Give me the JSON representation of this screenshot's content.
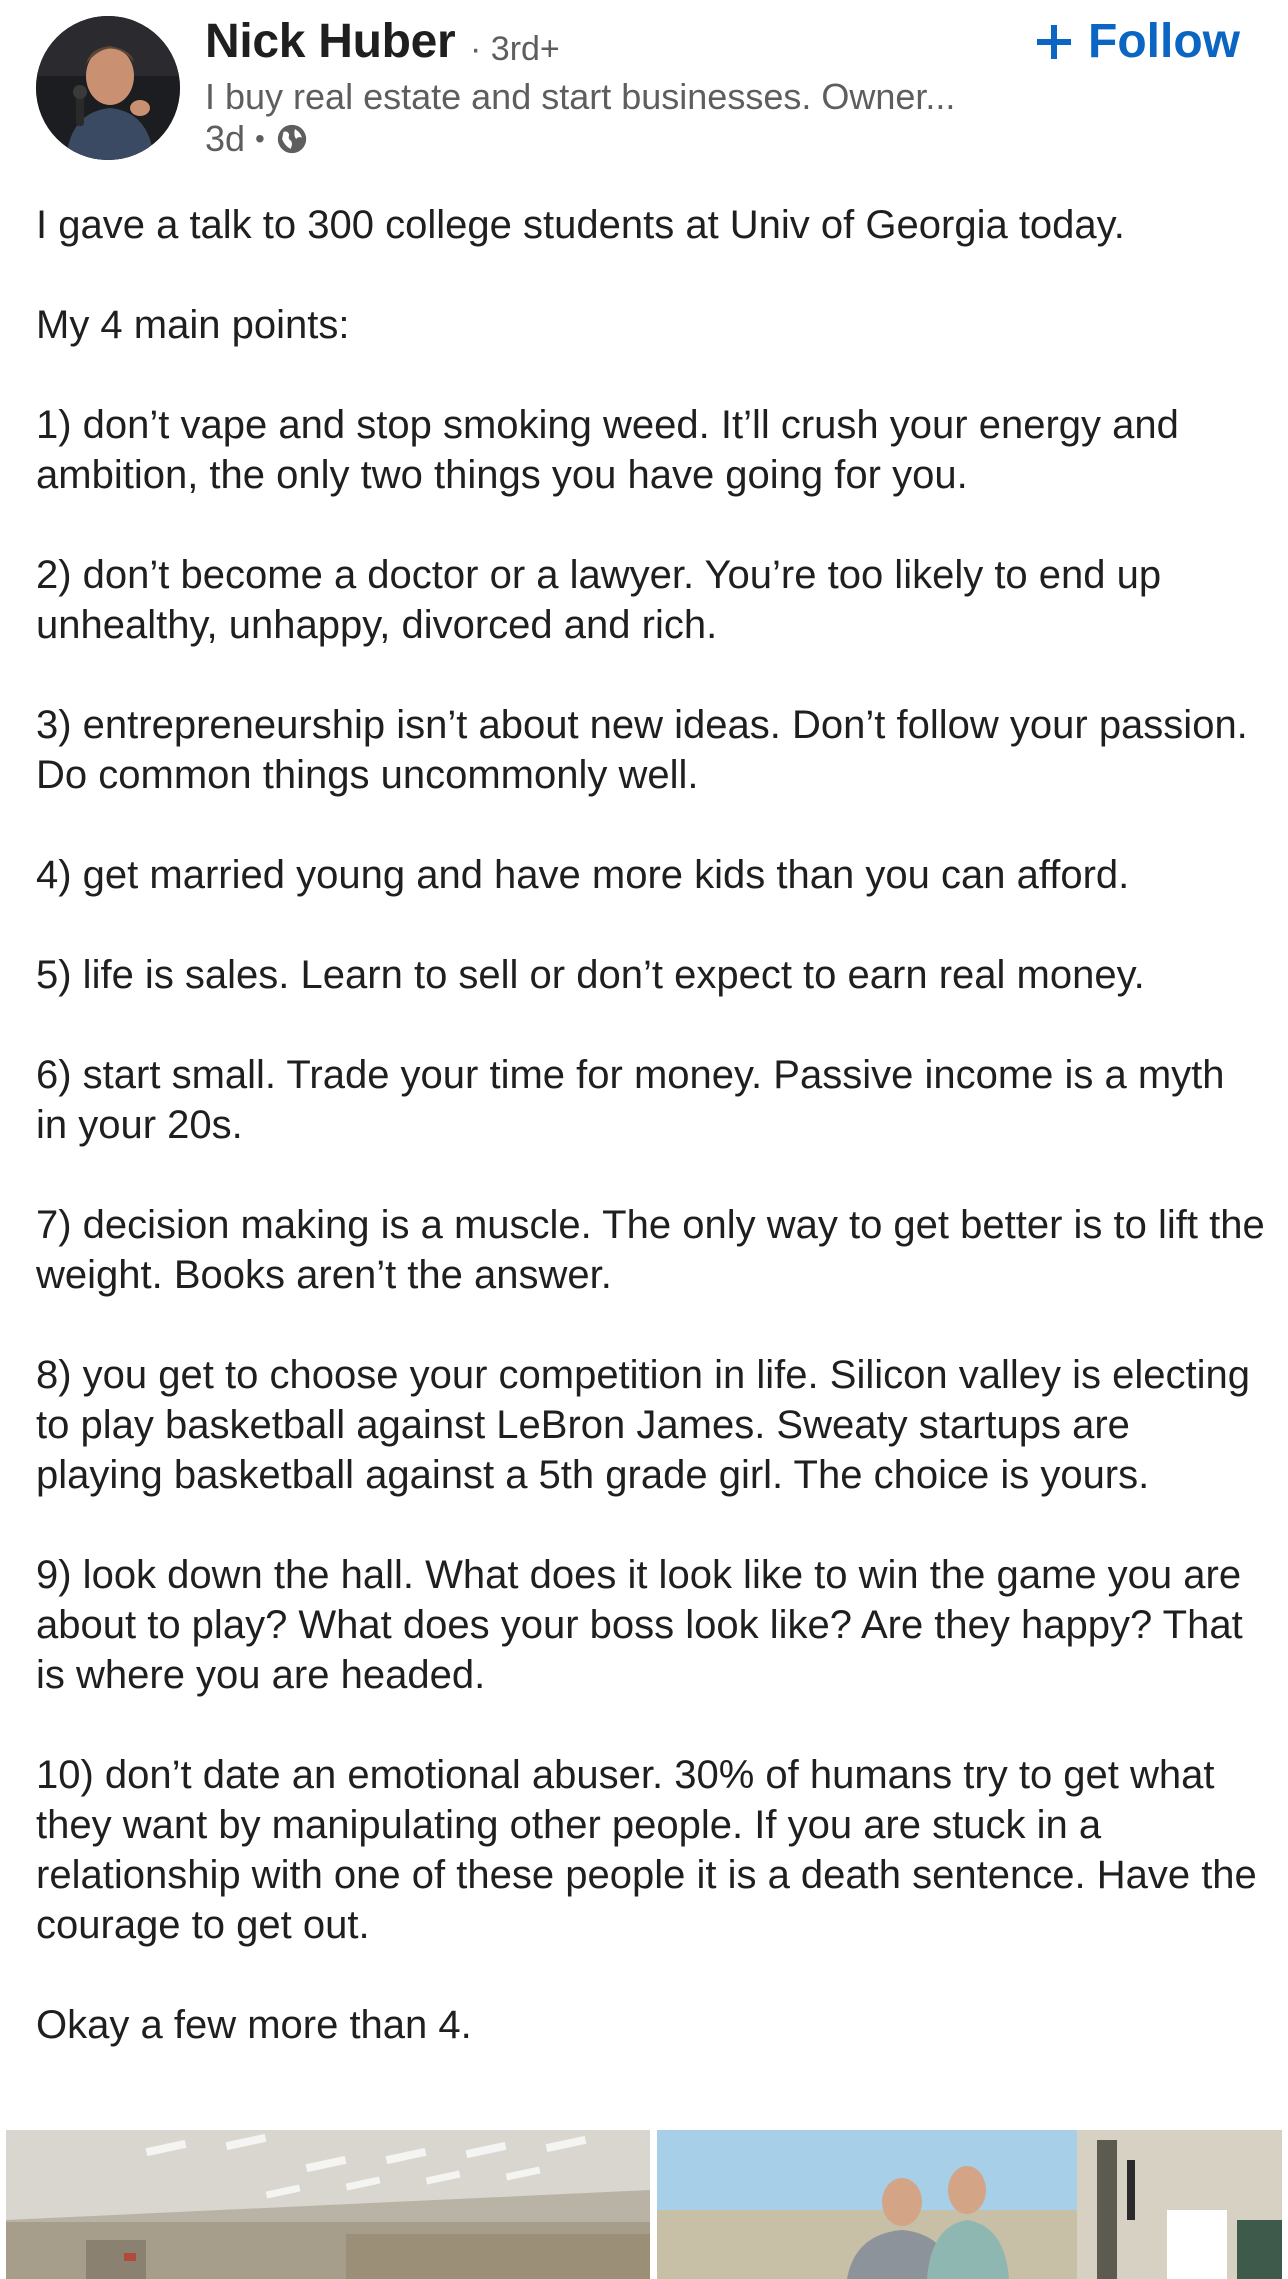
{
  "author": {
    "name": "Nick Huber",
    "degree": "3rd+",
    "headline": "I buy real estate and start businesses. Owner...",
    "time_ago": "3d",
    "visibility_icon": "globe-icon",
    "avatar_icon": "profile-photo"
  },
  "follow": {
    "label": "Follow",
    "icon": "plus-icon",
    "color": "#0a66c2"
  },
  "post": {
    "paragraphs": [
      "I gave a talk to 300 college students at Univ of Georgia today.",
      "My 4 main points:",
      "1) don’t vape and stop smoking weed. It’ll crush your energy and ambition, the only two things you have going for you.",
      "2) don’t become a doctor or a lawyer. You’re too likely to end up unhealthy, unhappy, divorced and rich.",
      "3) entrepreneurship isn’t about new ideas. Don’t follow your passion. Do common things uncommonly well.",
      "4) get married young and have more kids than you can afford.",
      "5) life is sales. Learn to sell or don’t expect to earn real money.",
      "6) start small. Trade your time for money. Passive income is a myth in your 20s.",
      "7) decision making is a muscle. The only way to get better is to lift the weight. Books aren’t the answer.",
      "8) you get to choose your competition in life. Silicon valley is electing to play basketball against LeBron James. Sweaty startups are playing basketball against a 5th grade girl. The choice is yours.",
      "9) look down the hall. What does it look like to win the game you are about to play? What does your boss look like? Are they happy? That is where you are headed.",
      "10) don’t date an emotional abuser. 30% of humans try to get what they want by manipulating other people. If you are stuck in a relationship with one of these people it is a death sentence. Have the courage to get out.",
      "Okay a few more than 4."
    ]
  },
  "media": {
    "images": [
      {
        "icon": "lecture-hall-photo"
      },
      {
        "icon": "two-men-portrait-photo"
      }
    ]
  }
}
